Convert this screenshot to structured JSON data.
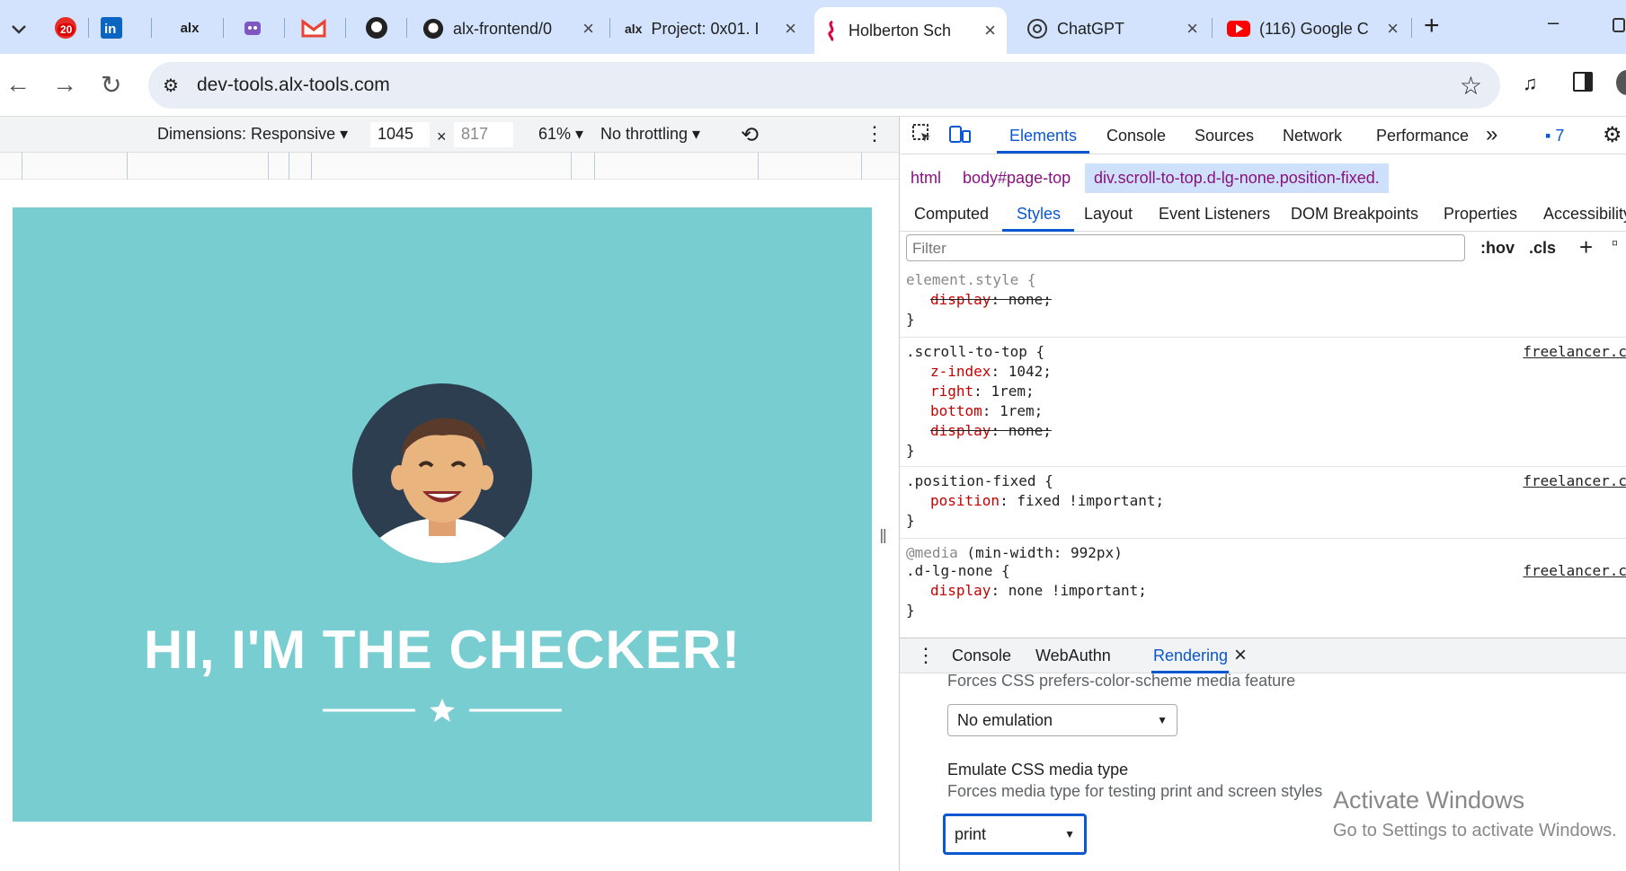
{
  "tabs": {
    "pinned_badge": "20",
    "pinned_alx_label": "alx",
    "items": [
      {
        "label": "alx-frontend/0",
        "icon": "github-icon"
      },
      {
        "label": "Project: 0x01. I",
        "icon": "alx-icon",
        "icon_text": "alx"
      },
      {
        "label": "Holberton Sch",
        "icon": "holberton-icon",
        "active": true
      },
      {
        "label": "ChatGPT",
        "icon": "chatgpt-icon"
      },
      {
        "label": "(116) Google C",
        "icon": "youtube-icon"
      }
    ],
    "new_tab": "+",
    "minimize": "–"
  },
  "address": {
    "url": "dev-tools.alx-tools.com"
  },
  "device_toolbar": {
    "dimensions": "Dimensions: Responsive ▾",
    "width": "1045",
    "times": "×",
    "height": "817",
    "zoom": "61% ▾",
    "throttling": "No throttling ▾"
  },
  "page": {
    "hero_title": "HI, I'M THE CHECKER!",
    "hero_bg": "#78cdd1"
  },
  "devtools": {
    "tabs": [
      "Elements",
      "Console",
      "Sources",
      "Network",
      "Performance"
    ],
    "more": "»",
    "issues_count": "7",
    "breadcrumbs": [
      "html",
      "body#page-top",
      "div.scroll-to-top.d-lg-none.position-fixed."
    ],
    "subtabs": [
      "Computed",
      "Styles",
      "Layout",
      "Event Listeners",
      "DOM Breakpoints",
      "Properties",
      "Accessibility"
    ],
    "filter_placeholder": "Filter",
    "hov": ":hov",
    "cls": ".cls",
    "rules": {
      "element_style": {
        "selector": "element.style {",
        "prop": "display",
        "value": " none;",
        "close": "}"
      },
      "scroll_to_top": {
        "selector": ".scroll-to-top {",
        "src": "freelancer.c",
        "z_prop": "z-index",
        "z_val": " 1042;",
        "r_prop": "right",
        "r_val": " 1rem;",
        "b_prop": "bottom",
        "b_val": " 1rem;",
        "d_prop": "display",
        "d_val": " none;",
        "close": "}"
      },
      "position_fixed": {
        "selector": ".position-fixed {",
        "src": "freelancer.c",
        "prop": "position",
        "value": " fixed !important;",
        "close": "}"
      },
      "d_lg_none": {
        "media": "@media",
        "query": " (min-width: 992px)",
        "selector": ".d-lg-none {",
        "src": "freelancer.c",
        "prop": "display",
        "value": " none !important;",
        "close": "}"
      }
    },
    "drawer": {
      "tabs": [
        "Console",
        "WebAuthn",
        "Rendering"
      ],
      "active": "Rendering",
      "close": "×"
    },
    "rendering": {
      "prefers_desc": "Forces CSS prefers-color-scheme media feature",
      "prefers_value": "No emulation",
      "media_title": "Emulate CSS media type",
      "media_desc": "Forces media type for testing print and screen styles",
      "media_value": "print"
    }
  },
  "watermark": {
    "line1": "Activate Windows",
    "line2": "Go to Settings to activate Windows."
  }
}
